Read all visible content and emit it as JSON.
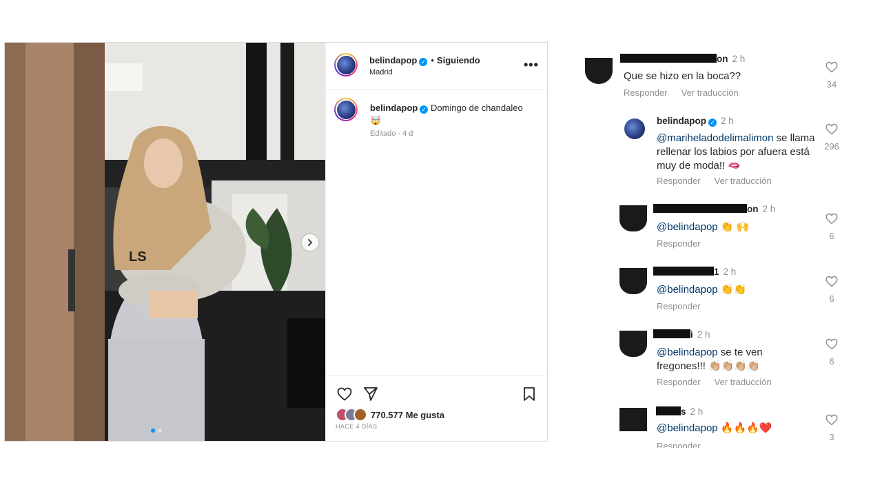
{
  "post": {
    "username": "belindapop",
    "follow_status": "Siguiendo",
    "separator": "•",
    "location": "Madrid",
    "more_label": "•••",
    "caption": "Domingo de chandaleo 🤯",
    "edited_label": "Editado · 4 d",
    "likes_count": "770.577",
    "likes_suffix": "Me gusta",
    "age_label": "HACE 4 DÍAS",
    "photo_sweatshirt_text": "LS",
    "carousel": {
      "slides": 2,
      "active": 0
    }
  },
  "comments": [
    {
      "name_tail": "on",
      "time": "2 h",
      "text": "Que se hizo en la boca??",
      "actions": [
        "Responder",
        "Ver traducción"
      ],
      "likes": "34"
    },
    {
      "name": "belindapop",
      "time": "2 h",
      "mention": "@mariheladodelimalimon",
      "text": " se llama rellenar los labios por afuera está muy de moda!! 🫦",
      "actions": [
        "Responder",
        "Ver traducción"
      ],
      "likes": "296"
    },
    {
      "name_tail": "on",
      "time": "2 h",
      "mention": "@belindapop",
      "text": " 👏 🙌",
      "actions": [
        "Responder"
      ],
      "likes": "6"
    },
    {
      "name_tail": "1",
      "time": "2 h",
      "mention": "@belindapop",
      "text": " 👏👏",
      "actions": [
        "Responder"
      ],
      "likes": "6"
    },
    {
      "name_tail": "i",
      "time": "2 h",
      "mention": "@belindapop",
      "text": " se te ven fregones!!! 👏🏼👏🏼👏🏼👏🏼",
      "actions": [
        "Responder",
        "Ver traducción"
      ],
      "likes": "6"
    },
    {
      "name_tail": "s",
      "time": "2 h",
      "mention": "@belindapop",
      "text": " 🔥🔥🔥❤️",
      "actions": [
        "Responder"
      ],
      "likes": "3"
    }
  ]
}
